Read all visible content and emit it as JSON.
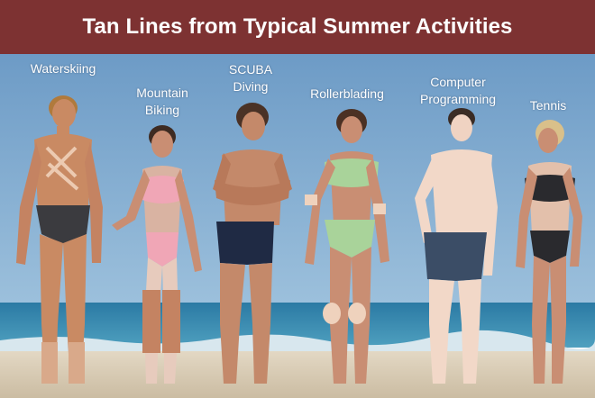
{
  "title": "Tan Lines from Typical Summer Activities",
  "labels": {
    "waterskiing": "Waterskiing",
    "mountain_biking": "Mountain\nBiking",
    "scuba_diving": "SCUBA\nDiving",
    "rollerblading": "Rollerblading",
    "computer_programming": "Computer\nProgramming",
    "tennis": "Tennis"
  },
  "colors": {
    "header": "#7d3232",
    "title_text": "#ffffff",
    "label_text": "#ffffff",
    "sky": "#6f9cc4",
    "sea": "#2f7fa8",
    "sand": "#d9cdb7"
  }
}
